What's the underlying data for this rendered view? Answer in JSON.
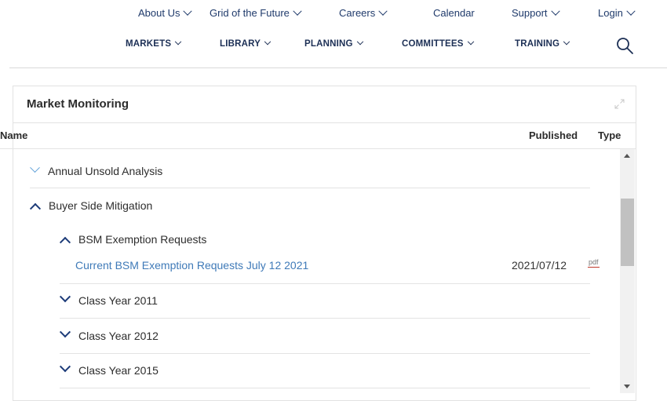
{
  "top_nav": {
    "items": [
      {
        "label": "About Us",
        "dropdown": true
      },
      {
        "label": "Grid of the Future",
        "dropdown": true
      },
      {
        "label": "Careers",
        "dropdown": true
      },
      {
        "label": "Calendar",
        "dropdown": false
      },
      {
        "label": "Support",
        "dropdown": true
      },
      {
        "label": "Login",
        "dropdown": true
      }
    ]
  },
  "main_nav": {
    "items": [
      {
        "label": "MARKETS"
      },
      {
        "label": "LIBRARY"
      },
      {
        "label": "PLANNING"
      },
      {
        "label": "COMMITTEES"
      },
      {
        "label": "TRAINING"
      }
    ],
    "search_icon": "search-icon"
  },
  "panel": {
    "title": "Market Monitoring",
    "expand_icon": "expand-icon",
    "columns": {
      "name": "Name",
      "published": "Published",
      "type": "Type"
    },
    "rows": [
      {
        "label": "Annual Unsold Analysis",
        "state": "collapsed"
      },
      {
        "label": "Buyer Side Mitigation",
        "state": "expanded"
      },
      {
        "label": "BSM Exemption Requests",
        "state": "expanded"
      },
      {
        "label": "Class Year 2011",
        "state": "collapsed"
      },
      {
        "label": "Class Year 2012",
        "state": "collapsed"
      },
      {
        "label": "Class Year 2015",
        "state": "collapsed"
      }
    ],
    "document": {
      "title": "Current BSM Exemption Requests July 12 2021",
      "published": "2021/07/12",
      "type": "pdf"
    }
  },
  "colors": {
    "nav_text": "#1f3a6b",
    "link": "#3f7ab8",
    "chevron": "#1c3b78",
    "pdf_underline": "#c0392b"
  }
}
